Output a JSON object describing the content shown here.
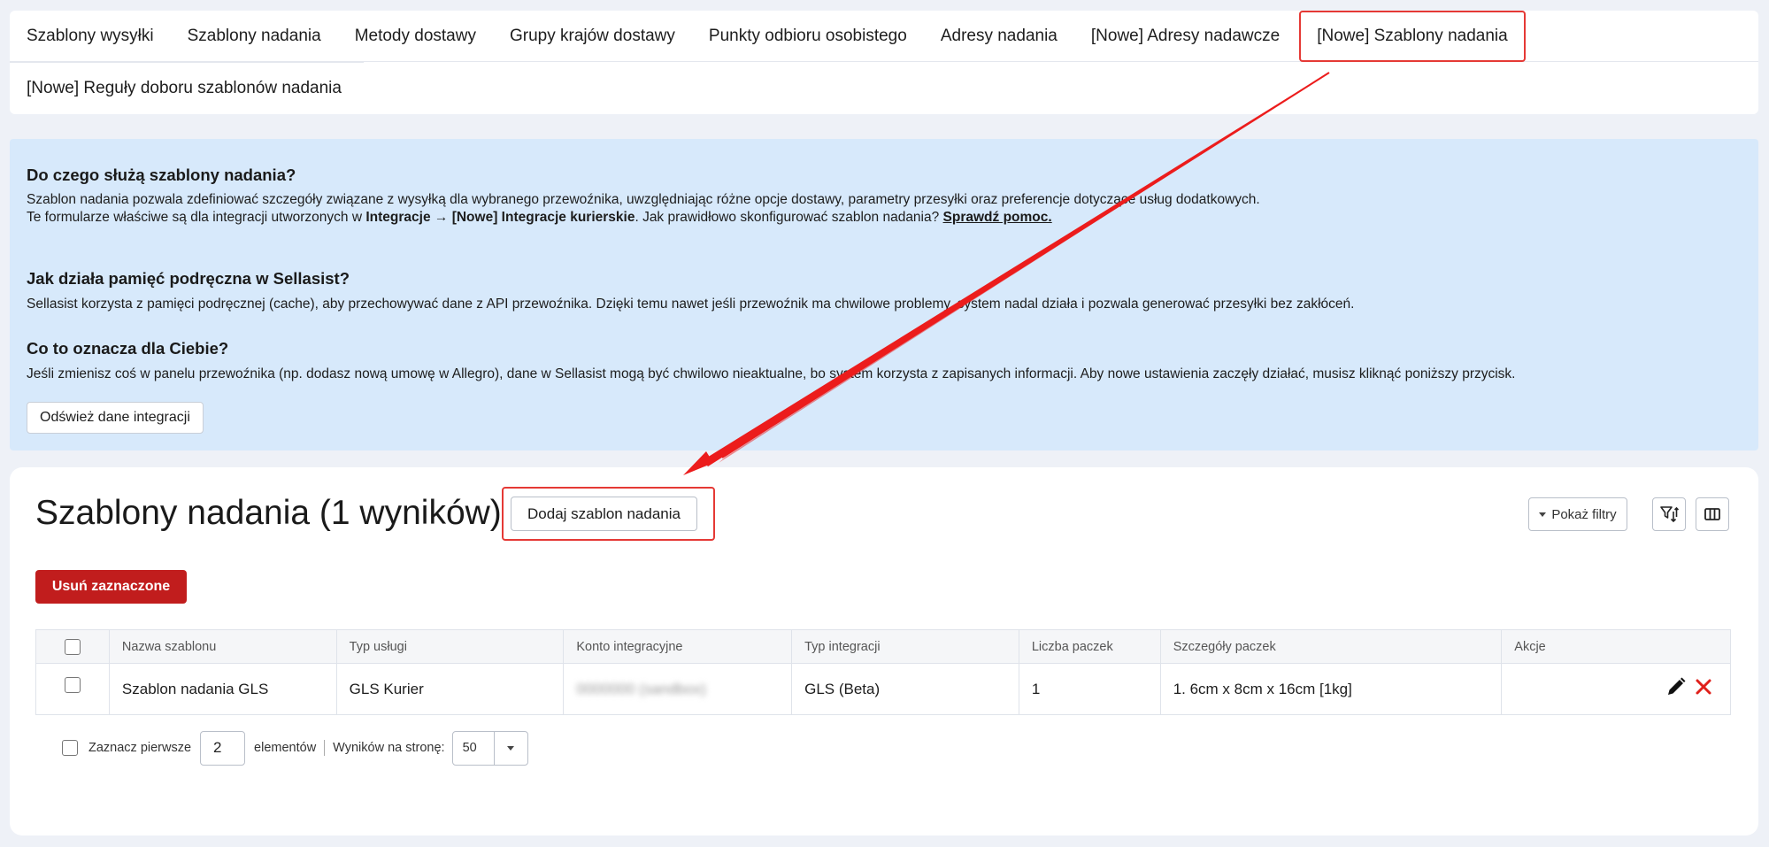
{
  "tabs": [
    {
      "label": "Szablony wysyłki",
      "active": false
    },
    {
      "label": "Szablony nadania",
      "active": false
    },
    {
      "label": "Metody dostawy",
      "active": false
    },
    {
      "label": "Grupy krajów dostawy",
      "active": false
    },
    {
      "label": "Punkty odbioru osobistego",
      "active": false
    },
    {
      "label": "Adresy nadania",
      "active": false
    },
    {
      "label": "[Nowe] Adresy nadawcze",
      "active": false
    },
    {
      "label": "[Nowe] Szablony nadania",
      "active": true
    },
    {
      "label": "[Nowe] Reguły doboru szablonów nadania",
      "active": false
    }
  ],
  "info": {
    "q1_title": "Do czego służą szablony nadania?",
    "q1_line1": "Szablon nadania pozwala zdefiniować szczegóły związane z wysyłką dla wybranego przewoźnika, uwzględniając różne opcje dostawy, parametry przesyłki oraz preferencje dotyczące usług dodatkowych.",
    "q1_line2_a": "Te formularze właściwe są dla integracji utworzonych w ",
    "q1_line2_b": "Integracje → [Nowe] Integracje kurierskie",
    "q1_line2_c": ". Jak prawidłowo skonfigurować szablon nadania? ",
    "q1_help_link": "Sprawdź pomoc.",
    "q2_title": "Jak działa pamięć podręczna w Sellasist?",
    "q2_text": "Sellasist korzysta z pamięci podręcznej (cache), aby przechowywać dane z API przewoźnika. Dzięki temu nawet jeśli przewoźnik ma chwilowe problemy, system nadal działa i pozwala generować przesyłki bez zakłóceń.",
    "q3_title": "Co to oznacza dla Ciebie?",
    "q3_text": "Jeśli zmienisz coś w panelu przewoźnika (np. dodasz nową umowę w Allegro), dane w Sellasist mogą być chwilowo nieaktualne, bo system korzysta z zapisanych informacji. Aby nowe ustawienia zaczęły działać, musisz kliknąć poniższy przycisk.",
    "refresh_button": "Odśwież dane integracji"
  },
  "main": {
    "title": "Szablony nadania (1 wyników)",
    "add_button": "Dodaj szablon nadania",
    "filters_button": "Pokaż filtry",
    "delete_selected_button": "Usuń zaznaczone"
  },
  "table": {
    "headers": [
      "Nazwa szablonu",
      "Typ usługi",
      "Konto integracyjne",
      "Typ integracji",
      "Liczba paczek",
      "Szczegóły paczek",
      "Akcje"
    ],
    "rows": [
      {
        "name": "Szablon nadania GLS",
        "service_type": "GLS Kurier",
        "account": "0000000 (sandbox)",
        "integration_type": "GLS (Beta)",
        "package_count": "1",
        "package_details": "1. 6cm x 8cm x 16cm [1kg]"
      }
    ]
  },
  "footer": {
    "select_first_label": "Zaznacz pierwsze",
    "select_first_value": "2",
    "elements_label": "elementów",
    "per_page_label": "Wyników na stronę:",
    "per_page_value": "50"
  },
  "colors": {
    "accent_red": "#e53935",
    "delete_red": "#c11d1d",
    "info_bg": "#d7e9fb",
    "page_bg": "#eef1f7"
  },
  "icons": {
    "row_edit": "pencil-icon",
    "row_delete": "close-icon",
    "filter_sort": "filter-sort-icon",
    "columns": "columns-icon"
  }
}
